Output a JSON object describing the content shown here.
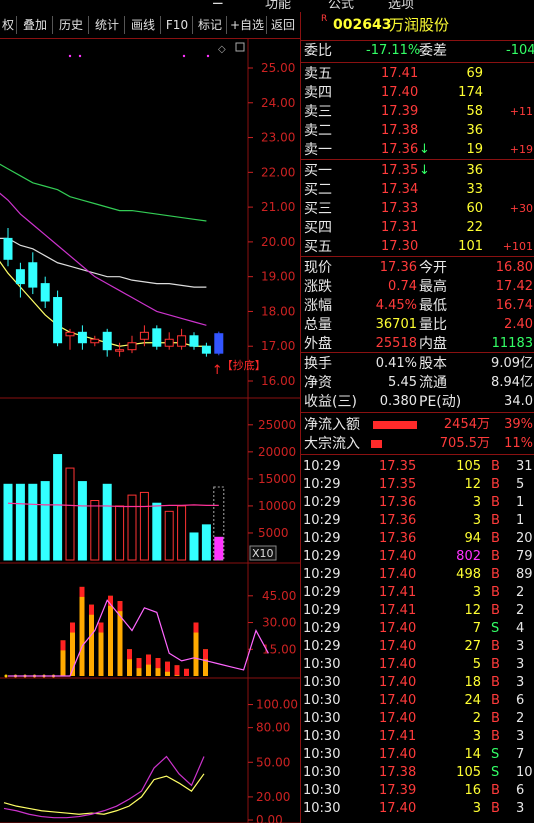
{
  "topmenu": [
    "功能",
    "公式",
    "选项"
  ],
  "toolbar": {
    "items": [
      "权",
      "叠加",
      "历史",
      "统计",
      "画线",
      "F10",
      "标记",
      "+自选",
      "返回"
    ]
  },
  "stock": {
    "badge": "R",
    "code": "002643",
    "name": "万润股份"
  },
  "committee": {
    "ratio_label": "委比",
    "ratio_value": "-17.11%",
    "diff_label": "委差",
    "diff_value": "-104"
  },
  "asks": [
    {
      "label": "卖五",
      "price": "17.41",
      "vol": "69",
      "chg": "",
      "arrow": ""
    },
    {
      "label": "卖四",
      "price": "17.40",
      "vol": "174",
      "chg": "",
      "arrow": ""
    },
    {
      "label": "卖三",
      "price": "17.39",
      "vol": "58",
      "chg": "+11",
      "arrow": ""
    },
    {
      "label": "卖二",
      "price": "17.38",
      "vol": "36",
      "chg": "",
      "arrow": ""
    },
    {
      "label": "卖一",
      "price": "17.36",
      "vol": "19",
      "chg": "+19",
      "arrow": "↓"
    }
  ],
  "bids": [
    {
      "label": "买一",
      "price": "17.35",
      "vol": "36",
      "chg": "",
      "arrow": "↓"
    },
    {
      "label": "买二",
      "price": "17.34",
      "vol": "33",
      "chg": "",
      "arrow": ""
    },
    {
      "label": "买三",
      "price": "17.33",
      "vol": "60",
      "chg": "+30",
      "arrow": ""
    },
    {
      "label": "买四",
      "price": "17.31",
      "vol": "22",
      "chg": "",
      "arrow": ""
    },
    {
      "label": "买五",
      "price": "17.30",
      "vol": "101",
      "chg": "+101",
      "arrow": ""
    }
  ],
  "quote": [
    {
      "l1": "现价",
      "v1": "17.36",
      "l2": "今开",
      "v2": "16.80",
      "c1": "red",
      "c2": "red"
    },
    {
      "l1": "涨跌",
      "v1": "0.74",
      "l2": "最高",
      "v2": "17.42",
      "c1": "red",
      "c2": "red"
    },
    {
      "l1": "涨幅",
      "v1": "4.45%",
      "l2": "最低",
      "v2": "16.74",
      "c1": "red",
      "c2": "red"
    },
    {
      "l1": "总量",
      "v1": "36701",
      "l2": "量比",
      "v2": "2.40",
      "c1": "yel",
      "c2": "red"
    },
    {
      "l1": "外盘",
      "v1": "25518",
      "l2": "内盘",
      "v2": "11183",
      "c1": "red",
      "c2": "grn"
    }
  ],
  "fundamentals": [
    {
      "l1": "换手",
      "v1": "0.41%",
      "l2": "股本",
      "v2": "9.09亿"
    },
    {
      "l1": "净资",
      "v1": "5.45",
      "l2": "流通",
      "v2": "8.94亿"
    },
    {
      "l1": "收益(三)",
      "v1": "0.380",
      "l2": "PE(动)",
      "v2": "34.0"
    }
  ],
  "flows": [
    {
      "label": "净流入额",
      "value": "2454万",
      "pct": "39%",
      "bar": 0.8
    },
    {
      "label": "大宗流入",
      "value": "705.5万",
      "pct": "11%",
      "bar": 0.2
    }
  ],
  "ticks": [
    {
      "t": "10:29",
      "p": "17.35",
      "v": "105",
      "s": "B",
      "n": "31",
      "vc": "yel"
    },
    {
      "t": "10:29",
      "p": "17.35",
      "v": "12",
      "s": "B",
      "n": "5",
      "vc": "yel"
    },
    {
      "t": "10:29",
      "p": "17.36",
      "v": "3",
      "s": "B",
      "n": "1",
      "vc": "yel"
    },
    {
      "t": "10:29",
      "p": "17.36",
      "v": "3",
      "s": "B",
      "n": "1",
      "vc": "yel"
    },
    {
      "t": "10:29",
      "p": "17.36",
      "v": "94",
      "s": "B",
      "n": "20",
      "vc": "yel"
    },
    {
      "t": "10:29",
      "p": "17.40",
      "v": "802",
      "s": "B",
      "n": "79",
      "vc": "mag"
    },
    {
      "t": "10:29",
      "p": "17.40",
      "v": "498",
      "s": "B",
      "n": "89",
      "vc": "yel"
    },
    {
      "t": "10:29",
      "p": "17.41",
      "v": "3",
      "s": "B",
      "n": "2",
      "vc": "yel"
    },
    {
      "t": "10:29",
      "p": "17.41",
      "v": "12",
      "s": "B",
      "n": "2",
      "vc": "yel"
    },
    {
      "t": "10:29",
      "p": "17.40",
      "v": "7",
      "s": "S",
      "n": "4",
      "vc": "yel"
    },
    {
      "t": "10:29",
      "p": "17.40",
      "v": "27",
      "s": "B",
      "n": "3",
      "vc": "yel"
    },
    {
      "t": "10:30",
      "p": "17.40",
      "v": "5",
      "s": "B",
      "n": "3",
      "vc": "yel"
    },
    {
      "t": "10:30",
      "p": "17.40",
      "v": "18",
      "s": "B",
      "n": "3",
      "vc": "yel"
    },
    {
      "t": "10:30",
      "p": "17.40",
      "v": "24",
      "s": "B",
      "n": "6",
      "vc": "yel"
    },
    {
      "t": "10:30",
      "p": "17.40",
      "v": "2",
      "s": "B",
      "n": "2",
      "vc": "yel"
    },
    {
      "t": "10:30",
      "p": "17.41",
      "v": "3",
      "s": "B",
      "n": "3",
      "vc": "yel"
    },
    {
      "t": "10:30",
      "p": "17.40",
      "v": "14",
      "s": "S",
      "n": "7",
      "vc": "yel"
    },
    {
      "t": "10:30",
      "p": "17.38",
      "v": "105",
      "s": "S",
      "n": "10",
      "vc": "yel"
    },
    {
      "t": "10:30",
      "p": "17.39",
      "v": "16",
      "s": "B",
      "n": "6",
      "vc": "yel"
    },
    {
      "t": "10:30",
      "p": "17.40",
      "v": "3",
      "s": "B",
      "n": "3",
      "vc": "yel"
    }
  ],
  "chart_axes": {
    "price_ticks": [
      "25.00",
      "24.00",
      "23.00",
      "22.00",
      "21.00",
      "20.00",
      "19.00",
      "18.00",
      "17.00",
      "16.00"
    ],
    "volume_ticks": [
      "25000",
      "20000",
      "15000",
      "10000",
      "5000"
    ],
    "volume_unit": "X10",
    "ind1_ticks": [
      "45.00",
      "30.00",
      "15.00"
    ],
    "ind2_ticks": [
      "100.00",
      "80.00",
      "50.00",
      "20.00",
      "0.00"
    ],
    "marker_label": "【抄底】"
  },
  "chart_data": {
    "type": "candlestick",
    "price_ylim": [
      15.5,
      25.6
    ],
    "candles": [
      {
        "o": 20.1,
        "c": 19.5,
        "h": 20.4,
        "l": 19.3
      },
      {
        "o": 19.2,
        "c": 18.8,
        "h": 19.4,
        "l": 18.4
      },
      {
        "o": 19.4,
        "c": 18.7,
        "h": 19.7,
        "l": 18.5
      },
      {
        "o": 18.8,
        "c": 18.3,
        "h": 19.0,
        "l": 18.1
      },
      {
        "o": 18.4,
        "c": 17.1,
        "h": 18.6,
        "l": 17.0
      },
      {
        "o": 17.3,
        "c": 17.4,
        "h": 17.5,
        "l": 16.9
      },
      {
        "o": 17.4,
        "c": 17.1,
        "h": 17.6,
        "l": 16.9
      },
      {
        "o": 17.1,
        "c": 17.2,
        "h": 17.3,
        "l": 17.0
      },
      {
        "o": 17.4,
        "c": 16.9,
        "h": 17.5,
        "l": 16.7
      },
      {
        "o": 16.9,
        "c": 16.9,
        "h": 17.1,
        "l": 16.7
      },
      {
        "o": 16.9,
        "c": 17.1,
        "h": 17.3,
        "l": 16.8
      },
      {
        "o": 17.2,
        "c": 17.4,
        "h": 17.6,
        "l": 17.0
      },
      {
        "o": 17.5,
        "c": 17.0,
        "h": 17.6,
        "l": 16.9
      },
      {
        "o": 17.0,
        "c": 17.2,
        "h": 17.4,
        "l": 16.9
      },
      {
        "o": 17.0,
        "c": 17.3,
        "h": 17.5,
        "l": 16.9
      },
      {
        "o": 17.3,
        "c": 17.0,
        "h": 17.4,
        "l": 16.9
      },
      {
        "o": 17.0,
        "c": 16.8,
        "h": 17.1,
        "l": 16.7
      },
      {
        "o": 16.8,
        "c": 17.36,
        "h": 17.42,
        "l": 16.74
      }
    ],
    "ma_short": [
      19.6,
      19.1,
      18.7,
      18.3,
      17.9,
      17.6,
      17.4,
      17.3,
      17.2,
      17.1,
      17.0,
      17.05,
      17.1,
      17.1,
      17.1,
      17.1,
      17.0,
      17.0
    ],
    "ma_mid": [
      21.5,
      21.2,
      20.8,
      20.5,
      20.2,
      19.9,
      19.6,
      19.3,
      19.0,
      18.8,
      18.6,
      18.4,
      18.2,
      18.0,
      17.9,
      17.8,
      17.7,
      17.6
    ],
    "ma_long": [
      22.3,
      22.1,
      21.9,
      21.7,
      21.6,
      21.5,
      21.3,
      21.2,
      21.1,
      21.0,
      20.9,
      20.9,
      20.85,
      20.8,
      20.75,
      20.7,
      20.65,
      20.6
    ],
    "ma_vlong": [
      20.1,
      20.1,
      19.9,
      19.8,
      19.6,
      19.4,
      19.3,
      19.2,
      19.1,
      19.0,
      19.0,
      18.9,
      18.85,
      18.8,
      18.8,
      18.75,
      18.7,
      18.7
    ],
    "volume_ylim": [
      0,
      27000
    ],
    "volumes": [
      14000,
      14000,
      14000,
      14500,
      19500,
      17000,
      14500,
      11000,
      14000,
      10000,
      12000,
      12500,
      10500,
      9000,
      10000,
      5000,
      6500,
      4200
    ],
    "volume_ma": [
      10500,
      10400,
      10300,
      10200,
      10200,
      10100,
      10000,
      10000,
      10000,
      9900,
      9900,
      9900,
      10000,
      10100,
      10100,
      10200,
      10100,
      10100
    ],
    "ind1_ylim": [
      0,
      55
    ],
    "ind1": [
      0,
      0,
      0,
      0,
      0,
      0,
      20,
      30,
      50,
      40,
      30,
      45,
      42,
      15,
      10,
      12,
      10,
      8,
      6,
      4,
      30,
      15
    ],
    "ind2_ylim": [
      0,
      110
    ],
    "ind2_a": [
      15,
      12,
      10,
      8,
      7,
      6,
      5,
      6,
      5,
      8,
      12,
      20,
      35,
      38,
      32,
      25,
      40
    ],
    "ind2_b": [
      10,
      8,
      5,
      3,
      2,
      2,
      3,
      5,
      8,
      12,
      18,
      25,
      45,
      55,
      40,
      30,
      55
    ]
  }
}
